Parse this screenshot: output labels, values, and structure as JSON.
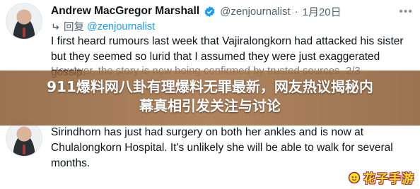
{
  "tweets": [
    {
      "display_name": "Andrew MacGregor Marshall",
      "handle": "@zenjournalist",
      "separator": "·",
      "date": "1月20日",
      "reply_prefix": "回复",
      "reply_to": "@zenjournalist",
      "text": "I first heard rumours last week that Vajiralongkorn had attacked his sister but they seemed so lurid that I assumed they were just exaggerated gossip.",
      "text_cont": "However, the story is now being confirmed by trusted sources. 2/3"
    },
    {
      "display_name": "",
      "handle": "",
      "text": "Sirindhorn has just had surgery on both her ankles and is now at Chulalongkorn Hospital. It's unlikely she will be able to walk for several months."
    }
  ],
  "banner": {
    "line1": "911爆料网八卦有理爆料无罪最新，网友热议揭秘内",
    "line2": "幕真相引发关注与讨论"
  },
  "watermark": {
    "text": "花子手游"
  },
  "colors": {
    "link": "#1d9bf0",
    "verified": "#1d9bf0",
    "banner": "#9a6a40",
    "watermark": "#f3e81f"
  }
}
